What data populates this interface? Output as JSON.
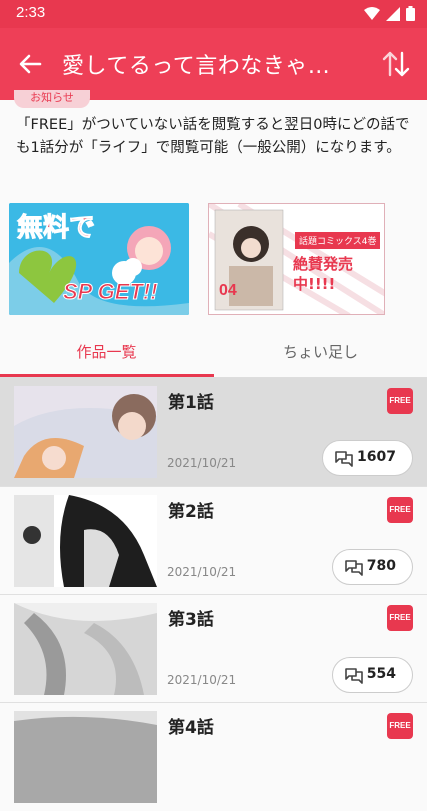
{
  "status_bar": {
    "time": "2:33"
  },
  "app_bar": {
    "title": "愛してるって言わなきゃ…"
  },
  "notice": {
    "tag": "お知らせ",
    "text": "「FREE」がついていない話を閲覧すると翌日0時にどの話でも1話分が「ライフ」で閲覧可能（一般公開）になります。"
  },
  "banners": {
    "left": {
      "text_main": "無料で",
      "text_sub": "SP GET!!"
    },
    "right": {
      "tag": "話題コミックス4巻",
      "headline": "絶賛発売中!!!!",
      "volume": "04"
    }
  },
  "tabs": [
    {
      "label": "作品一覧"
    },
    {
      "label": "ちょい足し"
    }
  ],
  "episodes": [
    {
      "title": "第1話",
      "date": "2021/10/21",
      "badge": "FREE",
      "comments": "1607"
    },
    {
      "title": "第2話",
      "date": "2021/10/21",
      "badge": "FREE",
      "comments": "780"
    },
    {
      "title": "第3話",
      "date": "2021/10/21",
      "badge": "FREE",
      "comments": "554"
    },
    {
      "title": "第4話",
      "badge": "FREE"
    }
  ],
  "colors": {
    "accent": "#ee3f57",
    "status": "#e8384f"
  }
}
